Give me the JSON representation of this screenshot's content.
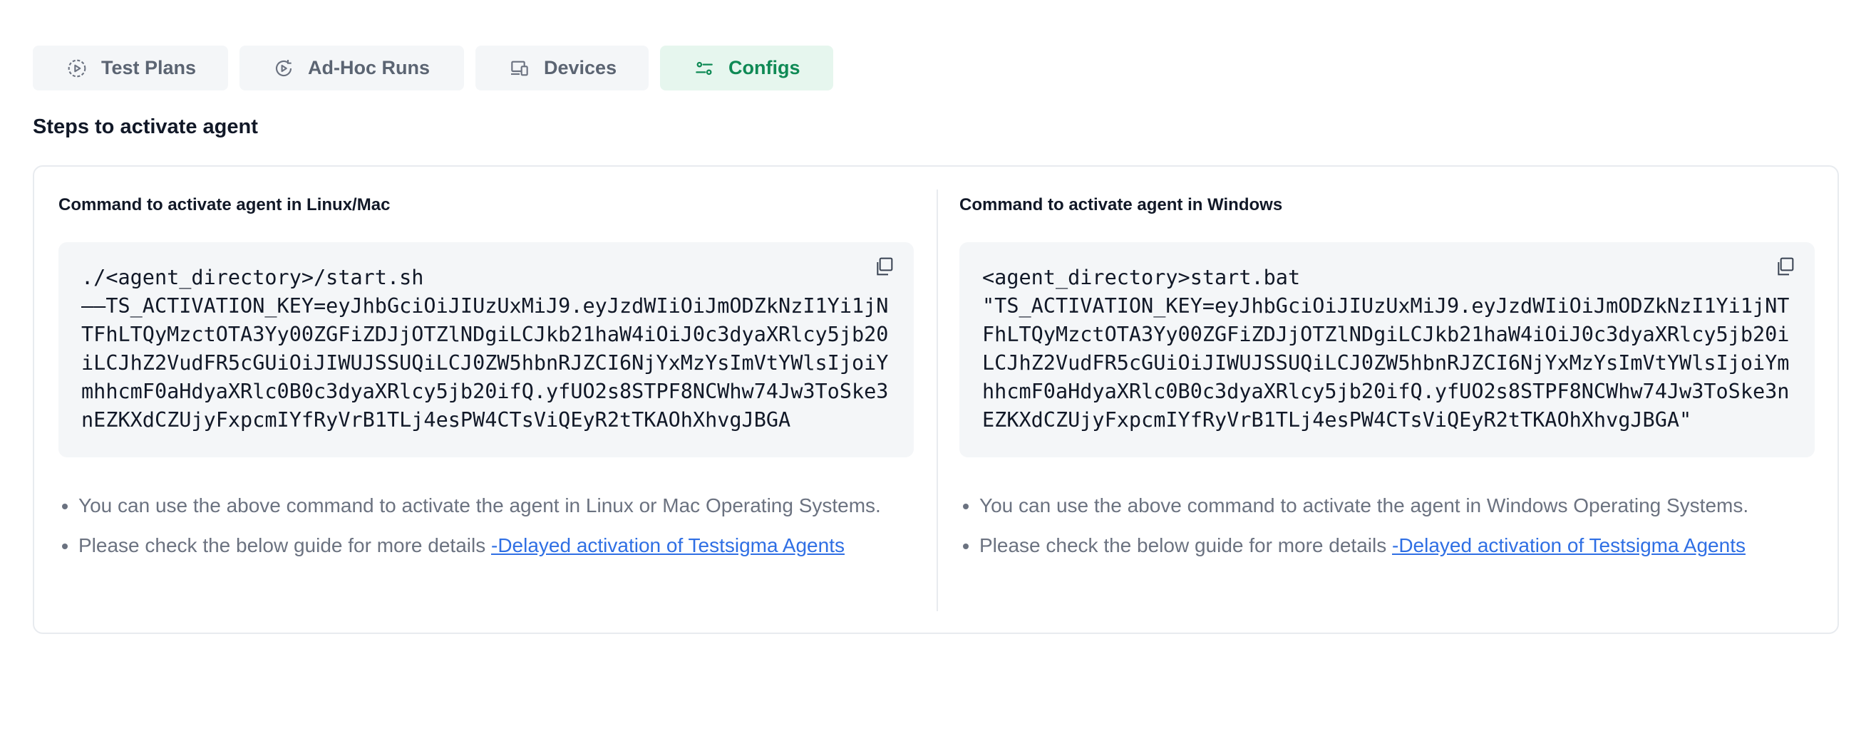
{
  "tabs": [
    {
      "label": "Test Plans",
      "icon": "play-circle-icon"
    },
    {
      "label": "Ad-Hoc Runs",
      "icon": "refresh-play-icon"
    },
    {
      "label": "Devices",
      "icon": "devices-icon"
    },
    {
      "label": "Configs",
      "icon": "sliders-icon",
      "active": true
    }
  ],
  "section_title": "Steps to activate agent",
  "linux": {
    "title": "Command to activate agent in Linux/Mac",
    "command": "./<agent_directory>/start.sh\n––TS_ACTIVATION_KEY=eyJhbGciOiJIUzUxMiJ9.eyJzdWIiOiJmODZkNzI1Yi1jNTFhLTQyMzctOTA3Yy00ZGFiZDJjOTZlNDgiLCJkb21haW4iOiJ0c3dyaXRlcy5jb20iLCJhZ2VudFR5cGUiOiJIWUJSSUQiLCJ0ZW5hbnRJZCI6NjYxMzYsImVtYWlsIjoiYmhhcmF0aHdyaXRlc0B0c3dyaXRlcy5jb20ifQ.yfUO2s8STPF8NCWhw74Jw3ToSke3nEZKXdCZUjyFxpcmIYfRyVrB1TLj4esPW4CTsViQEyR2tTKAOhXhvgJBGA",
    "bullet_1": "You can use the above command to activate the agent in Linux or Mac Operating Systems.",
    "bullet_2_prefix": "Please check the below guide for more details ",
    "bullet_2_link": "-Delayed activation of Testsigma Agents"
  },
  "windows": {
    "title": "Command to activate agent in Windows",
    "command": "<agent_directory>start.bat\n\"TS_ACTIVATION_KEY=eyJhbGciOiJIUzUxMiJ9.eyJzdWIiOiJmODZkNzI1Yi1jNTFhLTQyMzctOTA3Yy00ZGFiZDJjOTZlNDgiLCJkb21haW4iOiJ0c3dyaXRlcy5jb20iLCJhZ2VudFR5cGUiOiJIWUJSSUQiLCJ0ZW5hbnRJZCI6NjYxMzYsImVtYWlsIjoiYmhhcmF0aHdyaXRlc0B0c3dyaXRlcy5jb20ifQ.yfUO2s8STPF8NCWhw74Jw3ToSke3nEZKXdCZUjyFxpcmIYfRyVrB1TLj4esPW4CTsViQEyR2tTKAOhXhvgJBGA\"",
    "bullet_1": "You can use the above command to activate the agent in Windows Operating Systems.",
    "bullet_2_prefix": "Please check the below guide for more details ",
    "bullet_2_link": "-Delayed activation of Testsigma Agents"
  },
  "colors": {
    "accent": "#0f8a55",
    "accent_bg": "#e6f6ee",
    "link": "#2f6fe4"
  }
}
